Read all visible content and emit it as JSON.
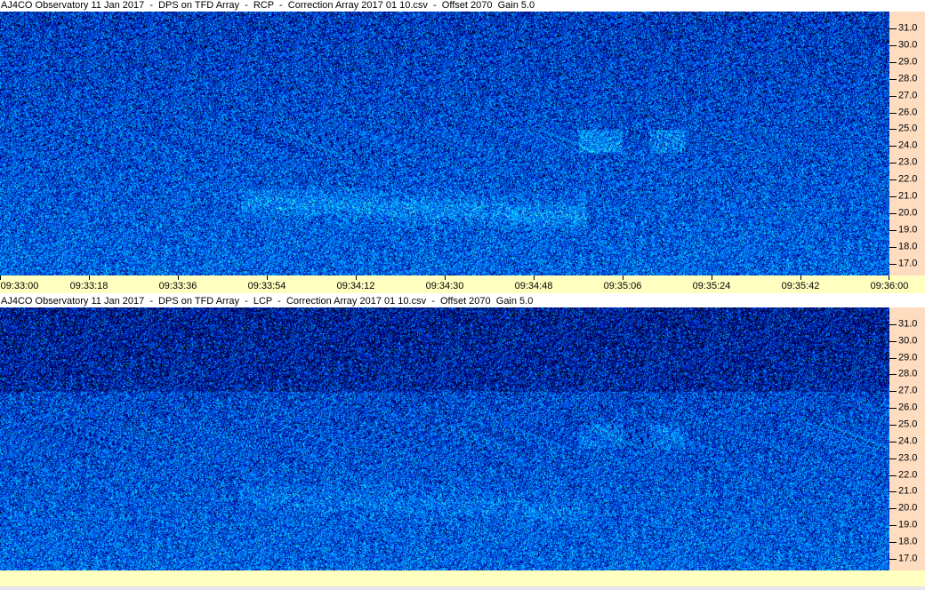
{
  "chart_data": [
    {
      "type": "heatmap",
      "title": "AJ4CO Observatory 11 Jan 2017  -  DPS on TFD Array  -  RCP  -  Correction Array 2017 01 10.csv  -  Offset 2070  Gain 5.0",
      "polarization": "RCP",
      "x_tick_labels": [
        "09:33:00",
        "09:33:18",
        "09:33:36",
        "09:33:54",
        "09:34:12",
        "09:34:30",
        "09:34:48",
        "09:35:06",
        "09:35:24",
        "09:35:42",
        "09:36:00"
      ],
      "xlim": [
        "09:33:00",
        "09:36:00"
      ],
      "y_tick_labels": [
        "31.0",
        "30.0",
        "29.0",
        "28.0",
        "27.0",
        "26.0",
        "25.0",
        "24.0",
        "23.0",
        "22.0",
        "21.0",
        "20.0",
        "19.0",
        "18.0",
        "17.0"
      ],
      "ylim": [
        16.3,
        32.0
      ],
      "colormap": [
        "#000000",
        "#000080",
        "#0040e0",
        "#0090ff",
        "#00d0ff",
        "#60ffe0",
        "#c0ff40",
        "#ffd000",
        "#ff2000"
      ]
    },
    {
      "type": "heatmap",
      "title": "AJ4CO Observatory 11 Jan 2017  -  DPS on TFD Array  -  LCP  -  Correction Array 2017 01 10.csv  -  Offset 2070  Gain 5.0",
      "polarization": "LCP",
      "x_tick_labels": [],
      "xlim": [
        "09:33:00",
        "09:36:00"
      ],
      "y_tick_labels": [
        "31.0",
        "30.0",
        "29.0",
        "28.0",
        "27.0",
        "26.0",
        "25.0",
        "24.0",
        "23.0",
        "22.0",
        "21.0",
        "20.0",
        "19.0",
        "18.0",
        "17.0"
      ],
      "ylim": [
        16.3,
        32.0
      ],
      "colormap": [
        "#000000",
        "#000080",
        "#0040e0",
        "#0090ff",
        "#00d0ff",
        "#60ffe0",
        "#c0ff40",
        "#ffd000",
        "#ff2000"
      ]
    }
  ],
  "colors": {
    "yaxis_bg": "#fddcc0",
    "xaxis_bg": "#ffffc0",
    "title_bg": "#ffffff"
  }
}
